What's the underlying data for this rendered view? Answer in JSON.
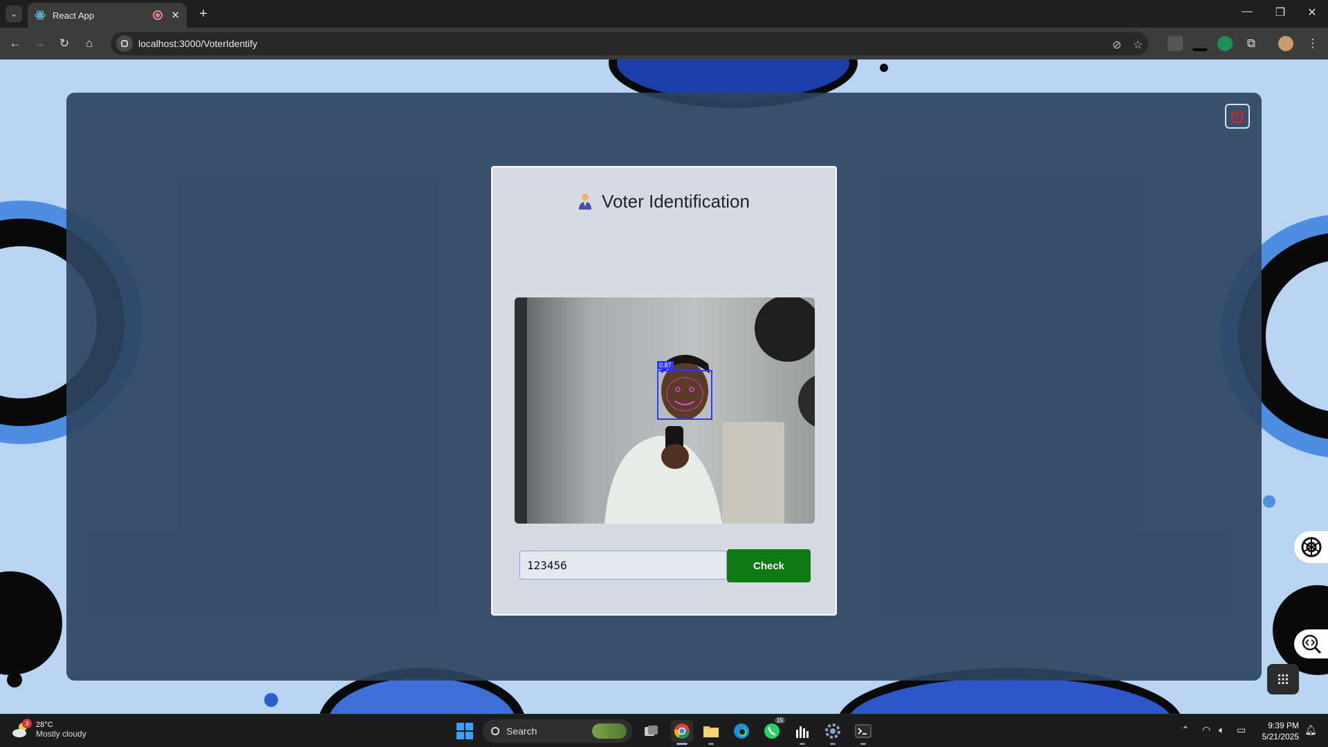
{
  "browser": {
    "tab_title": "React App",
    "url": "localhost:3000/VoterIdentify"
  },
  "page": {
    "card_title": "Voter Identification",
    "voter_id_value": "123456",
    "check_label": "Check",
    "face_score": "0.87"
  },
  "taskbar": {
    "weather_temp": "28°C",
    "weather_desc": "Mostly cloudy",
    "weather_badge": "3",
    "search_label": "Search",
    "whatsapp_badge": "15",
    "time": "9:39 PM",
    "date": "5/21/2025"
  },
  "colors": {
    "check_button": "#0f7a12",
    "panel": "#2d4460",
    "power_icon": "#e0212a",
    "face_box": "#2a3bff"
  }
}
